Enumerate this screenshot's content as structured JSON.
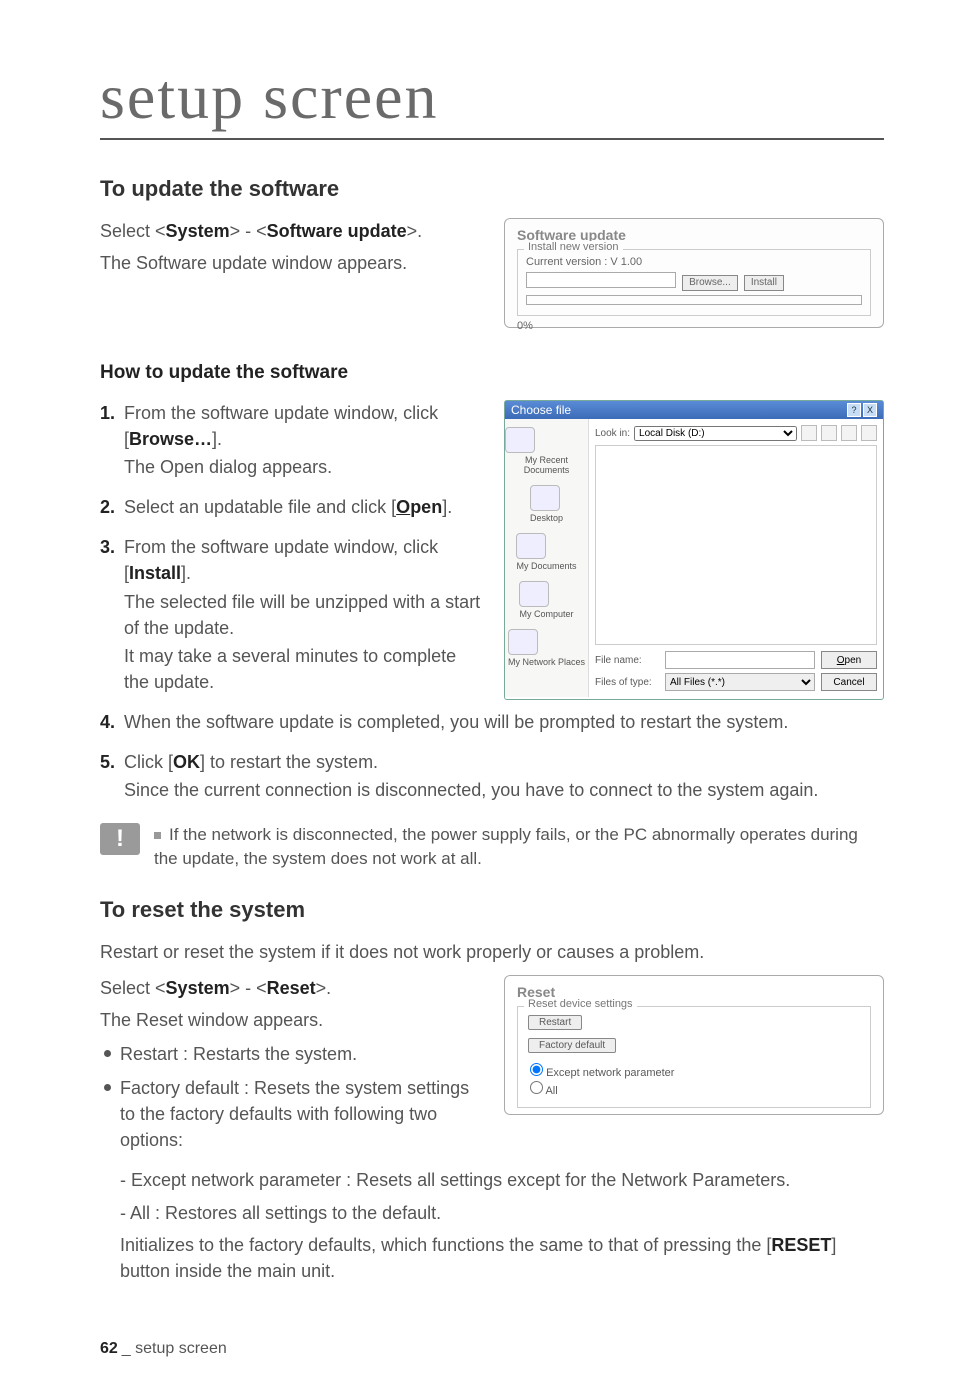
{
  "page_title": "setup screen",
  "h2_update": "To update the software",
  "update_p1_pre": "Select <",
  "update_p1_b1": "System",
  "update_p1_mid": "> - <",
  "update_p1_b2": "Software update",
  "update_p1_post": ">.",
  "update_p2": "The Software update window appears.",
  "shot_update": {
    "title": "Software update",
    "legend": "Install new version",
    "current": "Current version : V 1.00",
    "browse": "Browse...",
    "install": "Install",
    "progress": "0%"
  },
  "h3_howto": "How to update the software",
  "steps": {
    "s1a": "From the software update window, click [",
    "s1b": "Browse…",
    "s1c": "].",
    "s1d": "The Open dialog appears.",
    "s2a": "Select an updatable file and click [",
    "s2b_u": "O",
    "s2b_rest": "pen",
    "s2c": "].",
    "s3a": "From the software update window, click [",
    "s3b": "Install",
    "s3c": "].",
    "s3d": "The selected file will be unzipped with a start of the update.",
    "s3e": "It may take a several minutes to complete the update.",
    "s4": "When the software update is completed, you will be prompted to restart the system.",
    "s5a": "Click [",
    "s5b": "OK",
    "s5c": "] to restart the system.",
    "s5d": "Since the current connection is disconnected, you have to connect to the system again."
  },
  "choose": {
    "title": "Choose file",
    "lookin": "Look in:",
    "drive": "Local Disk (D:)",
    "side1": "My Recent Documents",
    "side2": "Desktop",
    "side3": "My Documents",
    "side4": "My Computer",
    "side5": "My Network Places",
    "filename_l": "File name:",
    "filetype_l": "Files of type:",
    "filetype_v": "All Files (*.*)",
    "open_u": "O",
    "open_rest": "pen",
    "cancel": "Cancel",
    "help": "?",
    "close": "X"
  },
  "note": "If the network is disconnected, the power supply fails, or the PC abnormally operates during the update, the system does not work at all.",
  "note_badge": "!",
  "h2_reset": "To reset the system",
  "reset_p1": "Restart or reset the system if it does not work properly or causes a problem.",
  "reset_p2_pre": "Select <",
  "reset_p2_b1": "System",
  "reset_p2_mid": "> - <",
  "reset_p2_b2": "Reset",
  "reset_p2_post": ">.",
  "reset_p3": "The Reset window appears.",
  "bul1": "Restart : Restarts the system.",
  "bul2": "Factory default : Resets the system settings to the factory defaults with following two options:",
  "dash1": "Except network parameter : Resets all settings except for the Network Parameters.",
  "dash2a": "All : Restores all settings to the default.",
  "dash2b_pre": "Initializes to the factory defaults, which functions the same to that of pressing the [",
  "dash2b_b": "RESET",
  "dash2b_post": "] button inside the main unit.",
  "shot_reset": {
    "title": "Reset",
    "legend": "Reset device settings",
    "restart": "Restart",
    "factory": "Factory default",
    "opt1": "Except network parameter",
    "opt2": "All"
  },
  "footer_num": "62",
  "footer_sep": "_ ",
  "footer_text": "setup screen"
}
